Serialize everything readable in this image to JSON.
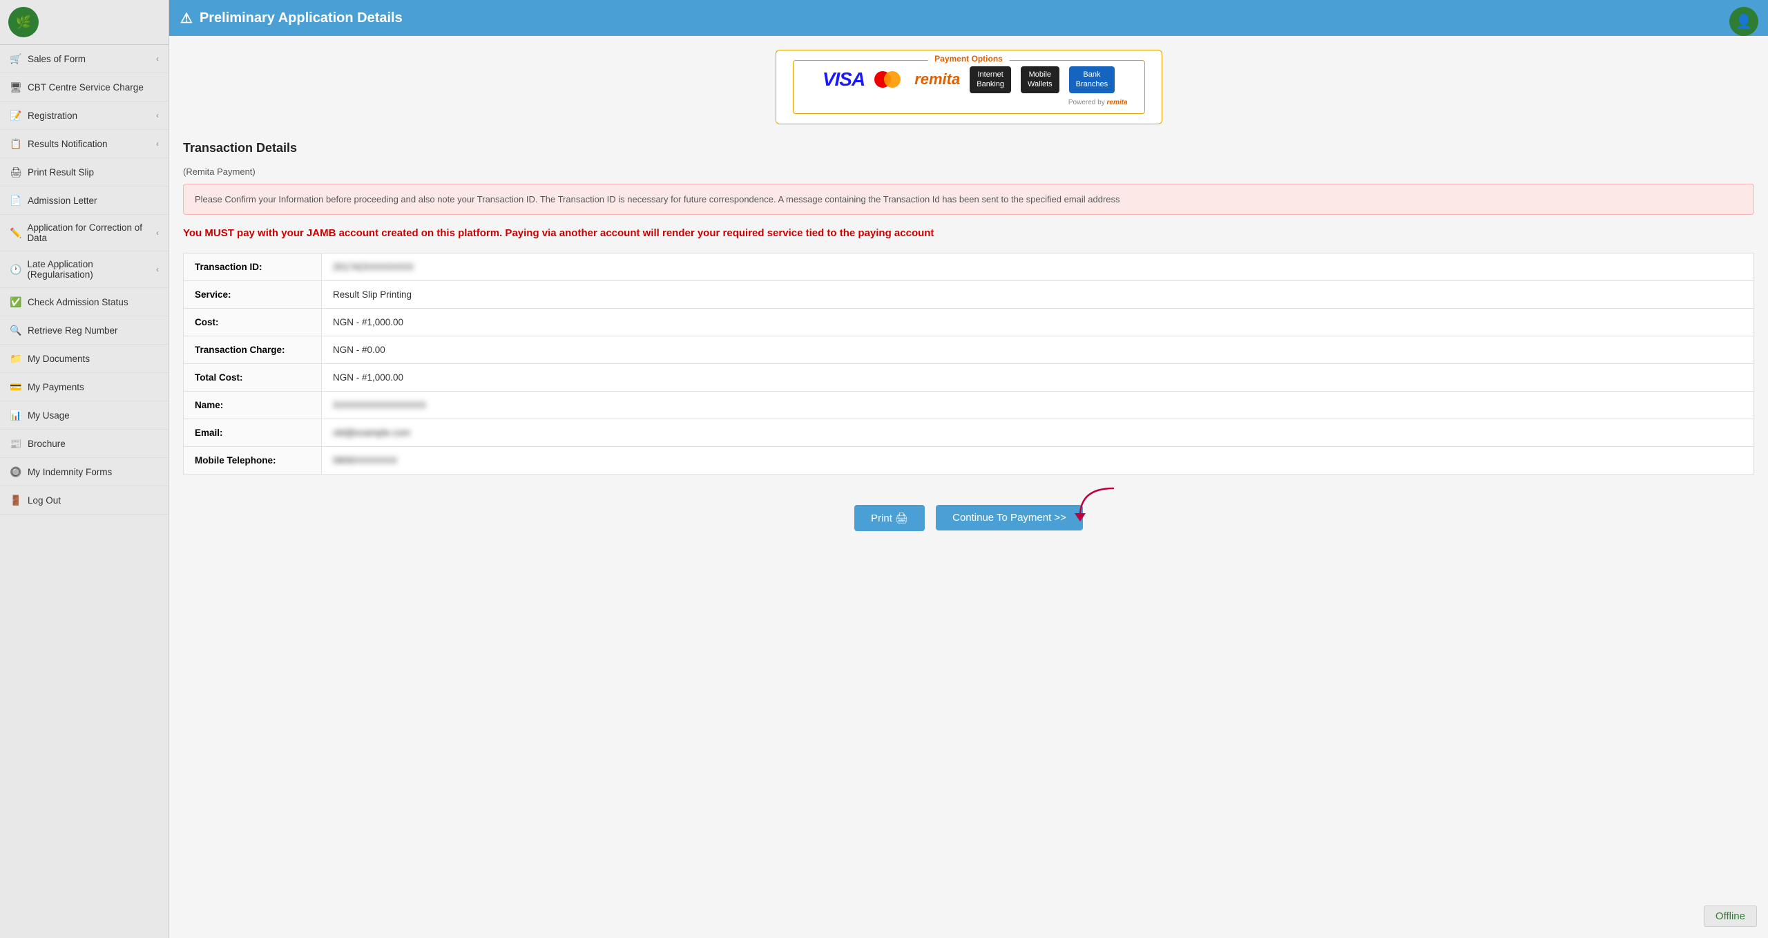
{
  "sidebar": {
    "items": [
      {
        "id": "sales-of-form",
        "label": "Sales of Form",
        "icon": "🛒",
        "hasChevron": true
      },
      {
        "id": "cbt-centre",
        "label": "CBT Centre Service Charge",
        "icon": "🖥",
        "hasChevron": false
      },
      {
        "id": "registration",
        "label": "Registration",
        "icon": "📝",
        "hasChevron": true
      },
      {
        "id": "results-notification",
        "label": "Results Notification",
        "icon": "📋",
        "hasChevron": true
      },
      {
        "id": "print-result-slip",
        "label": "Print Result Slip",
        "icon": "🖨",
        "hasChevron": false
      },
      {
        "id": "admission-letter",
        "label": "Admission Letter",
        "icon": "📄",
        "hasChevron": false
      },
      {
        "id": "application-correction",
        "label": "Application for Correction of Data",
        "icon": "✏️",
        "hasChevron": true
      },
      {
        "id": "late-application",
        "label": "Late Application (Regularisation)",
        "icon": "🕐",
        "hasChevron": true
      },
      {
        "id": "check-admission",
        "label": "Check Admission Status",
        "icon": "✅",
        "hasChevron": false
      },
      {
        "id": "retrieve-reg",
        "label": "Retrieve Reg Number",
        "icon": "🔍",
        "hasChevron": false
      },
      {
        "id": "my-documents",
        "label": "My Documents",
        "icon": "📁",
        "hasChevron": false
      },
      {
        "id": "my-payments",
        "label": "My Payments",
        "icon": "💳",
        "hasChevron": false
      },
      {
        "id": "my-usage",
        "label": "My Usage",
        "icon": "📊",
        "hasChevron": false
      },
      {
        "id": "brochure",
        "label": "Brochure",
        "icon": "📰",
        "hasChevron": false
      },
      {
        "id": "my-indemnity",
        "label": "My Indemnity Forms",
        "icon": "🔘",
        "hasChevron": false
      },
      {
        "id": "log-out",
        "label": "Log Out",
        "icon": "🚪",
        "hasChevron": false
      }
    ]
  },
  "header": {
    "title": "Preliminary Application Details",
    "warning_icon": "⚠",
    "chevron_icon": "⌄"
  },
  "payment_options": {
    "label": "Payment Options",
    "methods": [
      {
        "id": "visa",
        "label": "VISA"
      },
      {
        "id": "mastercard",
        "label": "Mastercard"
      },
      {
        "id": "remita",
        "label": "remita"
      },
      {
        "id": "internet-banking",
        "label": "Internet Banking"
      },
      {
        "id": "mobile-wallets",
        "label": "Mobile Wallets"
      },
      {
        "id": "bank-branches",
        "label": "Bank Branches"
      }
    ],
    "powered_by": "Powered by"
  },
  "transaction": {
    "title": "Transaction Details",
    "remita_label": "(Remita Payment)",
    "alert_message": "Please Confirm your Information before proceeding and also note your Transaction ID. The Transaction ID is necessary for future correspondence. A message containing the Transaction Id has been sent to the specified email address",
    "warning_text": "You MUST pay with your JAMB account created on this platform. Paying via another account will render your required service tied to the paying account",
    "rows": [
      {
        "label": "Transaction ID:",
        "value": "201742XXXXXXXX",
        "blurred": true
      },
      {
        "label": "Service:",
        "value": "Result Slip Printing",
        "blurred": false
      },
      {
        "label": "Cost:",
        "value": "NGN - #1,000.00",
        "blurred": false
      },
      {
        "label": "Transaction Charge:",
        "value": "NGN - #0.00",
        "blurred": false
      },
      {
        "label": "Total Cost:",
        "value": "NGN - #1,000.00",
        "blurred": false
      },
      {
        "label": "Name:",
        "value": "XXXXXXXXXXXXXXX",
        "blurred": true
      },
      {
        "label": "Email:",
        "value": "old@example.com",
        "blurred": true
      },
      {
        "label": "Mobile Telephone:",
        "value": "0806XXXXXXX",
        "blurred": true
      }
    ]
  },
  "buttons": {
    "print_label": "Print 🖨",
    "continue_label": "Continue To Payment >>"
  },
  "offline": {
    "label": "Offline"
  }
}
